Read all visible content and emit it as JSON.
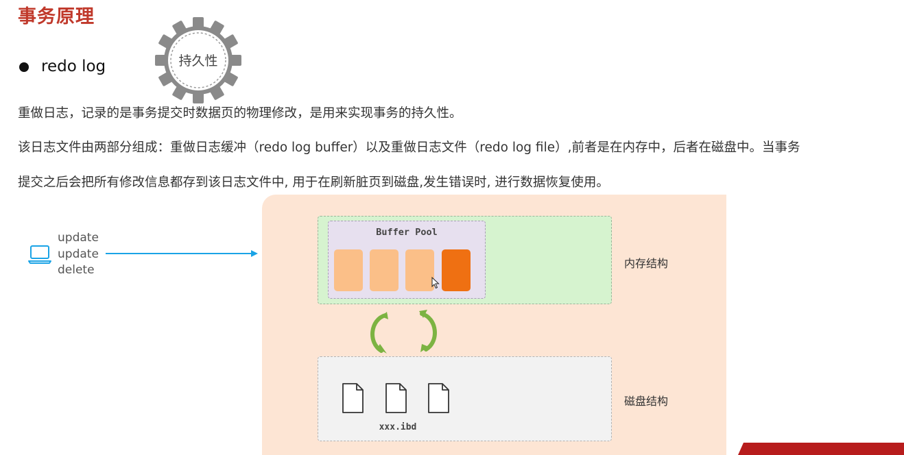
{
  "header": {
    "title": "事务原理"
  },
  "bullet": {
    "label": "redo log"
  },
  "badge": {
    "text": "持久性"
  },
  "paragraphs": {
    "p1": "重做日志，记录的是事务提交时数据页的物理修改，是用来实现事务的持久性。",
    "p2": "该日志文件由两部分组成：重做日志缓冲（redo log buffer）以及重做日志文件（redo log file）,前者是在内存中，后者在磁盘中。当事务",
    "p3": "提交之后会把所有修改信息都存到该日志文件中, 用于在刷新脏页到磁盘,发生错误时, 进行数据恢复使用。"
  },
  "diagram": {
    "client_ops": [
      "update",
      "update",
      "delete"
    ],
    "buffer_pool_label": "Buffer Pool",
    "memory_label": "内存结构",
    "disk_label": "磁盘结构",
    "file_label": "xxx.ibd",
    "pages": [
      {
        "state": "clean"
      },
      {
        "state": "clean"
      },
      {
        "state": "clean"
      },
      {
        "state": "dirty"
      }
    ],
    "file_icons": [
      "document-icon",
      "document-icon",
      "document-icon"
    ]
  },
  "colors": {
    "title": "#c0392b",
    "accent_arrow": "#1aa3e6",
    "memory_area": "#d6f3cf",
    "buffer_pool_area": "#e7e0ef",
    "disk_area": "#f2f2f2",
    "panel_background": "#fde5d4",
    "clean_page": "#fbbf88",
    "dirty_page": "#ef7012",
    "sync_arrows": "#7cb342",
    "banner": "#b71c1c"
  }
}
